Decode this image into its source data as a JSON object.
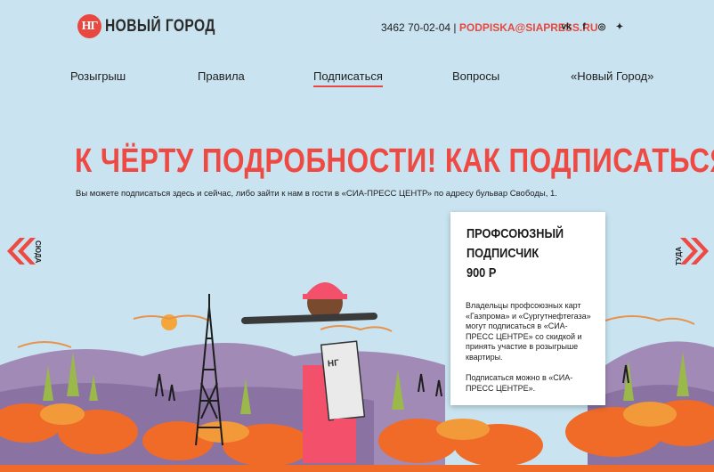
{
  "header": {
    "logo_mark": "НГ",
    "logo_text": "НОВЫЙ ГОРОД",
    "phone": "3462 70-02-04 |",
    "email": "PODPISKA@SIAPRESS.RU",
    "social_icons": [
      "vk-icon",
      "facebook-icon",
      "instagram-icon",
      "twitter-icon"
    ]
  },
  "nav": {
    "items": [
      {
        "label": "Розыгрыш"
      },
      {
        "label": "Правила"
      },
      {
        "label": "Подписаться"
      },
      {
        "label": "Вопросы"
      },
      {
        "label": "«Новый Город»"
      }
    ],
    "active": "Подписаться"
  },
  "main": {
    "headline": "К ЧЁРТУ ПОДРОБНОСТИ! КАК ПОДПИСАТЬСЯ?",
    "lead": "Вы можете подписаться здесь и сейчас, либо зайти к нам в гости в «СИА-ПРЕСС ЦЕНТР» по адресу бульвар Свободы, 1."
  },
  "slider": {
    "prev_label": "СЮДА",
    "next_label": "ТУДА"
  },
  "card": {
    "title_line1": "ПРОФСОЮЗНЫЙ",
    "title_line2": "ПОДПИСЧИК",
    "price": "900 Р",
    "text1": "Владельцы профсоюзных карт «Газпрома» и «Сургутнефтегаза» могут подписаться в «СИА-ПРЕСС ЦЕНТРЕ» со скидкой и принять участие в розыгрыше квартиры.",
    "text2": "Подписаться можно в «СИА-ПРЕСС ЦЕНТРЕ»."
  },
  "colors": {
    "accent": "#ee4a43",
    "background": "#c9e4f0"
  }
}
